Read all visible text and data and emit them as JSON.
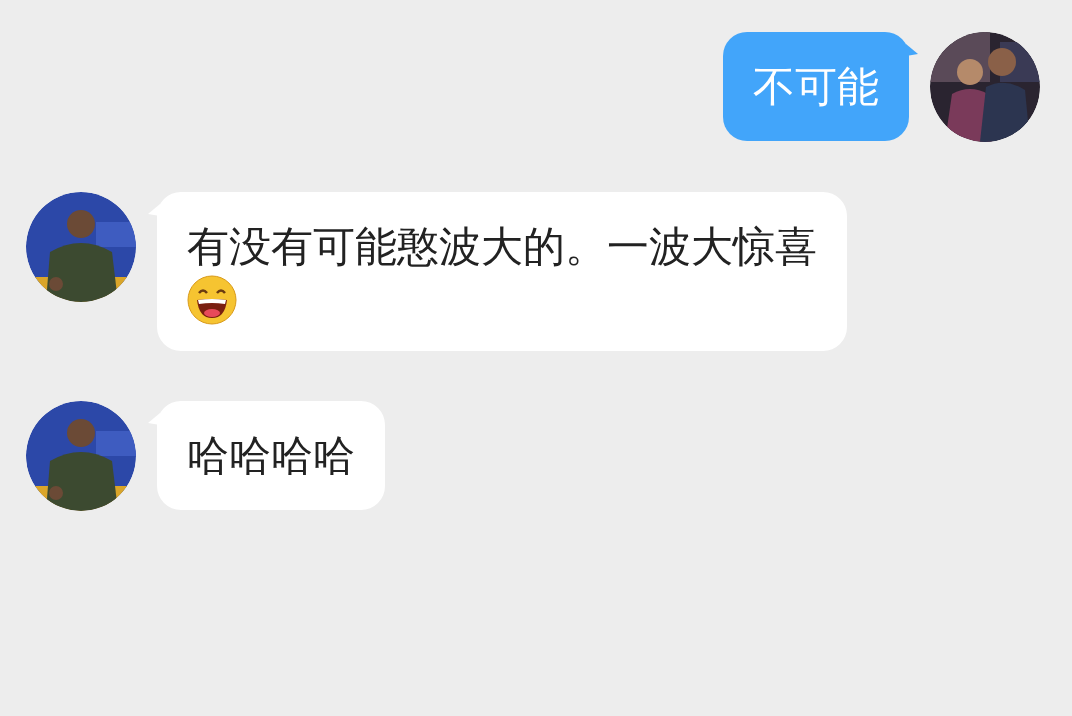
{
  "messages": [
    {
      "kind": "sent",
      "parts": [
        {
          "kind": "text",
          "text": "不可能"
        }
      ]
    },
    {
      "kind": "received",
      "parts": [
        {
          "kind": "text",
          "text": "有没有可能憨波大的。一波大惊喜"
        },
        {
          "kind": "emoji"
        }
      ]
    },
    {
      "kind": "received",
      "parts": [
        {
          "kind": "text",
          "text": "哈哈哈哈"
        }
      ]
    }
  ]
}
